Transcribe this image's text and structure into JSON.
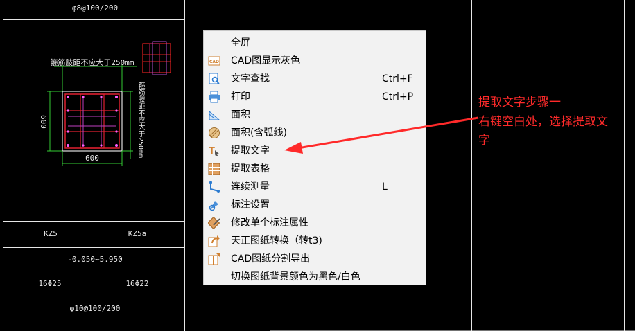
{
  "drawing": {
    "top_label": "φ8@100/200",
    "dim_top": "箍筋肢距不应大于250mm",
    "dim_right": "箍筋肢距不应大于250mm",
    "dim_left": "600",
    "dim_bottom": "600",
    "table": {
      "row1_left": "KZ5",
      "row1_right": "KZ5a",
      "row2": "-0.050~5.950",
      "row3_left": "16Φ25",
      "row3_right": "16Φ22",
      "row4": "φ10@100/200"
    }
  },
  "menu": {
    "items": [
      {
        "label": "全屏",
        "shortcut": "",
        "icon": "none"
      },
      {
        "label": "CAD图显示灰色",
        "shortcut": "",
        "icon": "cad-gray-icon"
      },
      {
        "label": "文字查找",
        "shortcut": "Ctrl+F",
        "icon": "text-search-icon"
      },
      {
        "label": "打印",
        "shortcut": "Ctrl+P",
        "icon": "printer-icon"
      },
      {
        "label": "面积",
        "shortcut": "",
        "icon": "area-icon"
      },
      {
        "label": "面积(含弧线)",
        "shortcut": "",
        "icon": "area-arc-icon"
      },
      {
        "label": "提取文字",
        "shortcut": "",
        "icon": "extract-text-icon"
      },
      {
        "label": "提取表格",
        "shortcut": "",
        "icon": "extract-table-icon"
      },
      {
        "label": "连续测量",
        "shortcut": "L",
        "icon": "continuous-measure-icon"
      },
      {
        "label": "标注设置",
        "shortcut": "",
        "icon": "annotation-settings-icon"
      },
      {
        "label": "修改单个标注属性",
        "shortcut": "",
        "icon": "edit-annotation-icon"
      },
      {
        "label": "天正图纸转换（转t3)",
        "shortcut": "",
        "icon": "tangent-convert-icon"
      },
      {
        "label": "CAD图纸分割导出",
        "shortcut": "",
        "icon": "cad-split-export-icon"
      },
      {
        "label": "切换图纸背景颜色为黑色/白色",
        "shortcut": "",
        "icon": "none"
      }
    ]
  },
  "annotation": {
    "line1": "提取文字步骤一",
    "line2": "右键空白处，选择提取文",
    "line3": "字",
    "color": "#ff2a2a"
  }
}
